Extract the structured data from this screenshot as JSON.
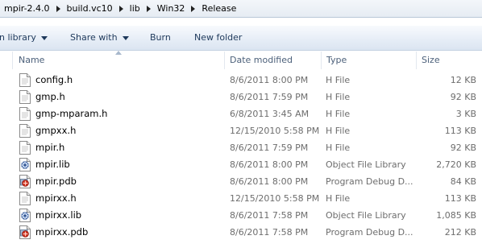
{
  "breadcrumb": [
    "mpir-2.4.0",
    "build.vc10",
    "lib",
    "Win32",
    "Release"
  ],
  "toolbar": {
    "include_in_library": "n library",
    "share_with": "Share with",
    "burn": "Burn",
    "new_folder": "New folder"
  },
  "columns": {
    "name": "Name",
    "date_modified": "Date modified",
    "type": "Type",
    "size": "Size"
  },
  "files": [
    {
      "name": "config.h",
      "date": "8/6/2011 8:00 PM",
      "type": "H File",
      "size": "12 KB",
      "icon": "document-icon"
    },
    {
      "name": "gmp.h",
      "date": "8/6/2011 7:59 PM",
      "type": "H File",
      "size": "92 KB",
      "icon": "document-icon"
    },
    {
      "name": "gmp-mparam.h",
      "date": "6/8/2011 3:45 AM",
      "type": "H File",
      "size": "3 KB",
      "icon": "document-icon"
    },
    {
      "name": "gmpxx.h",
      "date": "12/15/2010 5:58 PM",
      "type": "H File",
      "size": "113 KB",
      "icon": "document-icon"
    },
    {
      "name": "mpir.h",
      "date": "8/6/2011 7:59 PM",
      "type": "H File",
      "size": "92 KB",
      "icon": "document-icon"
    },
    {
      "name": "mpir.lib",
      "date": "8/6/2011 8:00 PM",
      "type": "Object File Library",
      "size": "2,720 KB",
      "icon": "library-icon"
    },
    {
      "name": "mpir.pdb",
      "date": "8/6/2011 8:00 PM",
      "type": "Program Debug D...",
      "size": "84 KB",
      "icon": "debug-database-icon"
    },
    {
      "name": "mpirxx.h",
      "date": "12/15/2010 5:58 PM",
      "type": "H File",
      "size": "113 KB",
      "icon": "document-icon"
    },
    {
      "name": "mpirxx.lib",
      "date": "8/6/2011 7:58 PM",
      "type": "Object File Library",
      "size": "1,085 KB",
      "icon": "library-icon"
    },
    {
      "name": "mpirxx.pdb",
      "date": "8/6/2011 7:58 PM",
      "type": "Program Debug D...",
      "size": "212 KB",
      "icon": "debug-database-icon"
    }
  ]
}
